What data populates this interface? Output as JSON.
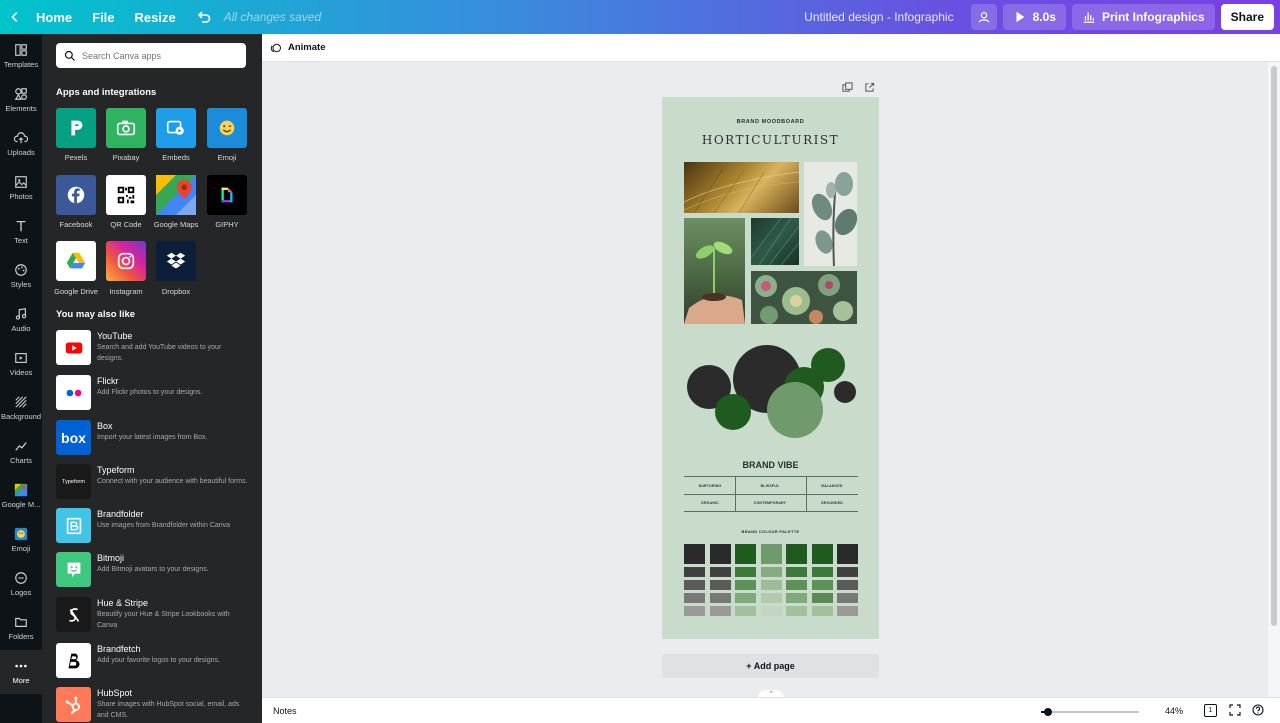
{
  "topbar": {
    "home": "Home",
    "file": "File",
    "resize": "Resize",
    "saved_status": "All changes saved",
    "doc_title": "Untitled design - Infographic",
    "play_duration": "8.0s",
    "print_label": "Print Infographics",
    "share": "Share"
  },
  "rail": [
    {
      "label": "Templates",
      "icon": "templates-icon"
    },
    {
      "label": "Elements",
      "icon": "elements-icon"
    },
    {
      "label": "Uploads",
      "icon": "uploads-icon"
    },
    {
      "label": "Photos",
      "icon": "photos-icon"
    },
    {
      "label": "Text",
      "icon": "text-icon"
    },
    {
      "label": "Styles",
      "icon": "styles-icon"
    },
    {
      "label": "Audio",
      "icon": "audio-icon"
    },
    {
      "label": "Videos",
      "icon": "videos-icon"
    },
    {
      "label": "Background",
      "icon": "background-icon"
    },
    {
      "label": "Charts",
      "icon": "charts-icon"
    },
    {
      "label": "Google M...",
      "icon": "google-maps-icon"
    },
    {
      "label": "Emoji",
      "icon": "emoji-icon"
    },
    {
      "label": "Logos",
      "icon": "logos-icon"
    },
    {
      "label": "Folders",
      "icon": "folders-icon"
    },
    {
      "label": "More",
      "icon": "more-icon"
    }
  ],
  "panel": {
    "search_placeholder": "Search Canva apps",
    "apps_title": "Apps and integrations",
    "apps": [
      {
        "label": "Pexels",
        "color": "#05a081"
      },
      {
        "label": "Pixabay",
        "color": "#2eb461"
      },
      {
        "label": "Embeds",
        "color": "#1e9ee8"
      },
      {
        "label": "Emoji",
        "color": "#1b8cd9"
      },
      {
        "label": "Facebook",
        "color": "#3b5998"
      },
      {
        "label": "QR Code",
        "color": "#ffffff"
      },
      {
        "label": "Google Maps",
        "color": "#e8eaed"
      },
      {
        "label": "GIPHY",
        "color": "#000000"
      },
      {
        "label": "Google Drive",
        "color": "#ffffff"
      },
      {
        "label": "Instagram",
        "color": "#d6249f"
      },
      {
        "label": "Dropbox",
        "color": "#0b1e3a"
      }
    ],
    "recommended_title": "You may also like",
    "recommended": [
      {
        "name": "YouTube",
        "desc": "Search and add YouTube videos to your designs."
      },
      {
        "name": "Flickr",
        "desc": "Add Flickr photos to your designs."
      },
      {
        "name": "Box",
        "desc": "Import your latest images from Box."
      },
      {
        "name": "Typeform",
        "desc": "Connect with your audience with beautiful forms."
      },
      {
        "name": "Brandfolder",
        "desc": "Use images from Brandfolder within Canva"
      },
      {
        "name": "Bitmoji",
        "desc": "Add Bitmoji avatars to your designs."
      },
      {
        "name": "Hue & Stripe",
        "desc": "Beautify your Hue & Stripe Lookbooks with Canva"
      },
      {
        "name": "Brandfetch",
        "desc": "Add your favorite logos to your designs."
      },
      {
        "name": "HubSpot",
        "desc": "Share images with HubSpot social, email, ads and CMS."
      }
    ],
    "box_logo": "box",
    "typeform_logo": "Typeform"
  },
  "editor": {
    "animate": "Animate",
    "add_page": "+ Add page",
    "notes": "Notes",
    "zoom": "44%",
    "zoom_fraction": 0.07,
    "page_count": "1"
  },
  "design": {
    "kicker": "BRAND MOODBOARD",
    "title": "HORTICULTURIST",
    "vibe_title": "BRAND VIBE",
    "vibe_words": [
      "NURTURING",
      "BLISSFUL",
      "BALANCED",
      "ORGANIC",
      "CONTEMPORARY",
      "GROUNDED"
    ],
    "palette_title": "BRAND COLOUR PALETTE",
    "bubble_colors": [
      "#2b2b2b",
      "#1f5a1f",
      "#6f9a6b"
    ],
    "palette_columns": [
      [
        "#2a2a2a",
        "#404040",
        "#5a5a5a",
        "#787878",
        "#9a9a9a"
      ],
      [
        "#2a2a2a",
        "#404040",
        "#5a5a5a",
        "#787878",
        "#9a9a9a"
      ],
      [
        "#1f5a1f",
        "#3c7a3a",
        "#5d9158",
        "#7eaa79",
        "#a2c09c"
      ],
      [
        "#6f9a6b",
        "#86ab82",
        "#9cbb98",
        "#b1c9ad",
        "#c3d6c0"
      ],
      [
        "#1f5a1f",
        "#3c7a3a",
        "#5d9158",
        "#7eaa79",
        "#a2c09c"
      ],
      [
        "#1f5a1f",
        "#3c7a3a",
        "#5d9158",
        "#5a8a55",
        "#a2c09c"
      ],
      [
        "#2a2a2a",
        "#404040",
        "#5a5a5a",
        "#787878",
        "#9a9a9a"
      ]
    ]
  }
}
